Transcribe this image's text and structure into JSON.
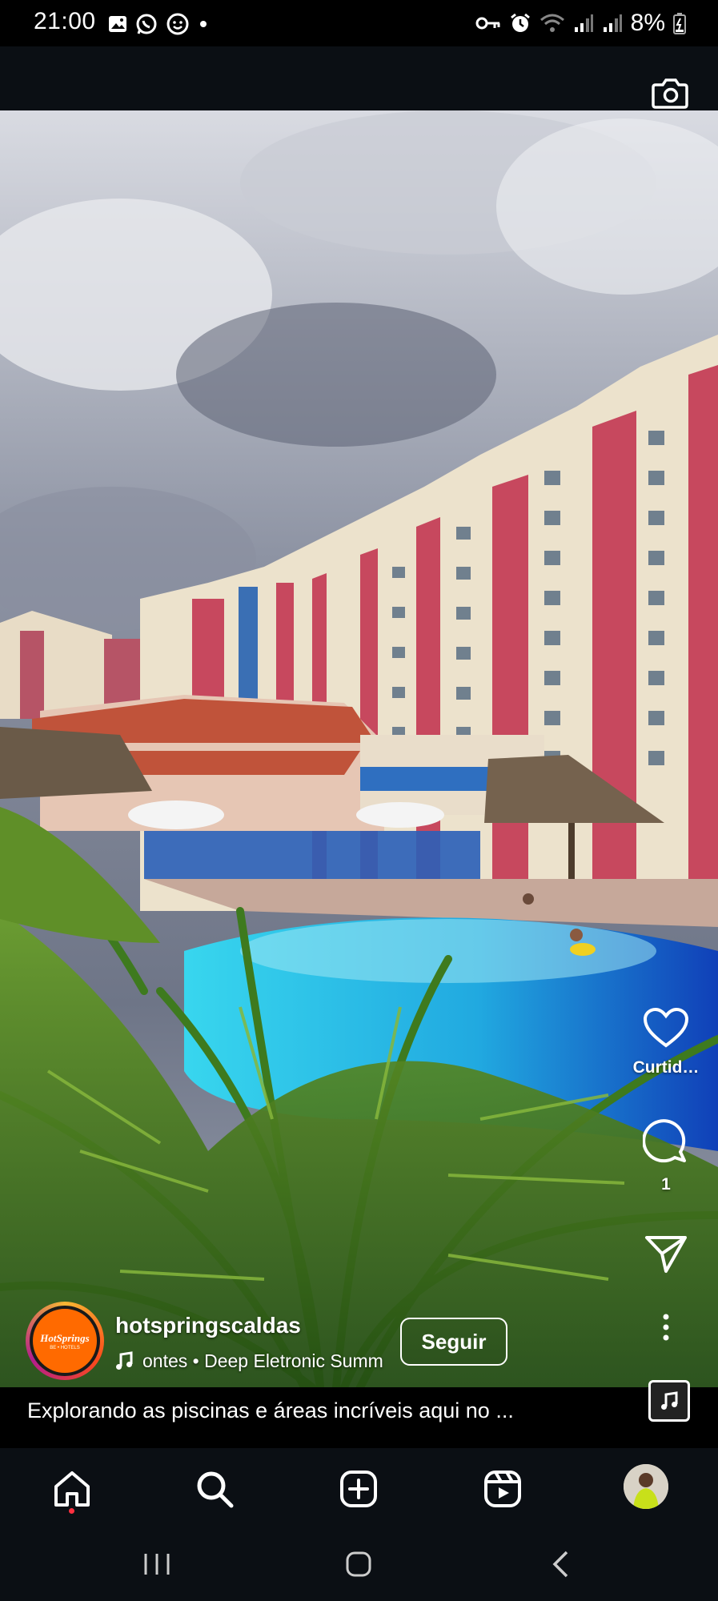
{
  "status_bar": {
    "time": "21:00",
    "battery": "8%",
    "left_icons": [
      "gallery-icon",
      "whatsapp-icon",
      "whatsapp-business-icon",
      "notification-dot"
    ],
    "right_icons": [
      "vpn-key-icon",
      "alarm-icon",
      "wifi-icon",
      "signal-icon",
      "signal-icon",
      "battery-icon"
    ]
  },
  "header": {
    "camera_icon": "camera-icon"
  },
  "reel": {
    "scene": "resort-pool-hotel-photo"
  },
  "actions": {
    "like_label": "Curtid…",
    "comment_count": "1",
    "share_icon": "send-icon",
    "more_icon": "more-vertical-icon"
  },
  "author": {
    "username": "hotspringscaldas",
    "avatar_brand": "HotSprings",
    "avatar_sub": "BE • HOTELS",
    "music": "Fontes • Deep Eletronic Summ",
    "music_visible": "ontes • Deep Eletronic Summ",
    "follow_label": "Seguir"
  },
  "caption": "Explorando as piscinas e áreas incríveis aqui no ...",
  "bottom_nav": [
    "home-icon",
    "search-icon",
    "create-icon",
    "reels-icon",
    "profile-avatar"
  ],
  "colors": {
    "background": "#000000",
    "nav_bg": "#0b0f14",
    "notification": "#ff3040"
  }
}
